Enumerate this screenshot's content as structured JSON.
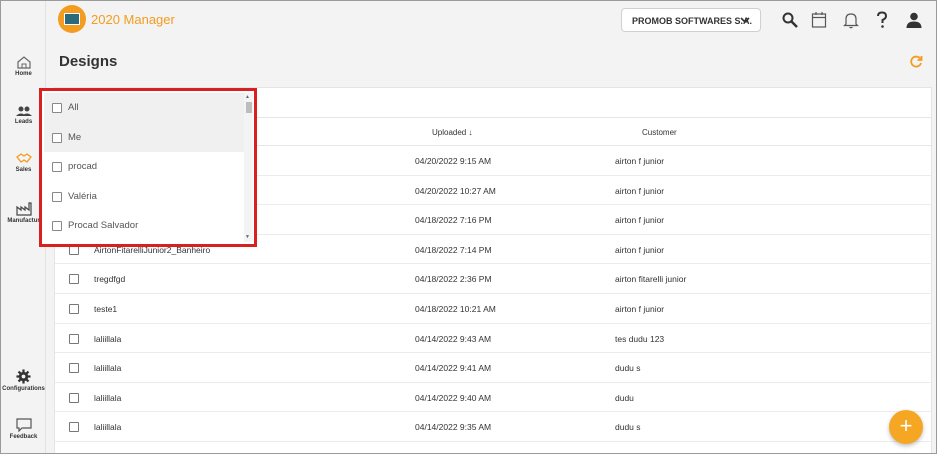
{
  "app": {
    "logo_text": "2020 Manager"
  },
  "header": {
    "company": "PROMOB SOFTWARES S.A."
  },
  "sidebar": {
    "items": [
      {
        "label": "Home"
      },
      {
        "label": "Leads"
      },
      {
        "label": "Sales"
      },
      {
        "label": "Manufactur"
      },
      {
        "label": "Configurations"
      },
      {
        "label": "Feedback"
      }
    ]
  },
  "page": {
    "title": "Designs"
  },
  "table": {
    "headers": {
      "uploaded": "Uploaded",
      "customer": "Customer"
    },
    "rows": [
      {
        "name": "",
        "uploaded": "04/20/2022 9:15 AM",
        "customer": "airton f junior"
      },
      {
        "name": "",
        "uploaded": "04/20/2022 10:27 AM",
        "customer": "airton f junior"
      },
      {
        "name": "",
        "uploaded": "04/18/2022 7:16 PM",
        "customer": "airton f junior"
      },
      {
        "name": "AirtonFitarelliJunior2_Banheiro",
        "uploaded": "04/18/2022 7:14 PM",
        "customer": "airton f junior"
      },
      {
        "name": "tregdfgd",
        "uploaded": "04/18/2022 2:36 PM",
        "customer": "airton fitarelli junior"
      },
      {
        "name": "teste1",
        "uploaded": "04/18/2022 10:21 AM",
        "customer": "airton f junior"
      },
      {
        "name": "laliillala",
        "uploaded": "04/14/2022 9:43 AM",
        "customer": "tes dudu 123"
      },
      {
        "name": "laliillala",
        "uploaded": "04/14/2022 9:41 AM",
        "customer": "dudu s"
      },
      {
        "name": "laliillala",
        "uploaded": "04/14/2022 9:40 AM",
        "customer": "dudu"
      },
      {
        "name": "laliillala",
        "uploaded": "04/14/2022 9:35 AM",
        "customer": "dudu s"
      }
    ]
  },
  "dropdown": {
    "options": [
      {
        "label": "All"
      },
      {
        "label": "Me"
      },
      {
        "label": "procad"
      },
      {
        "label": "Valéria"
      },
      {
        "label": "Procad Salvador"
      }
    ]
  },
  "fab": {
    "label": "+"
  },
  "colors": {
    "accent": "#f39c1f",
    "highlight_border": "#d7201f"
  }
}
